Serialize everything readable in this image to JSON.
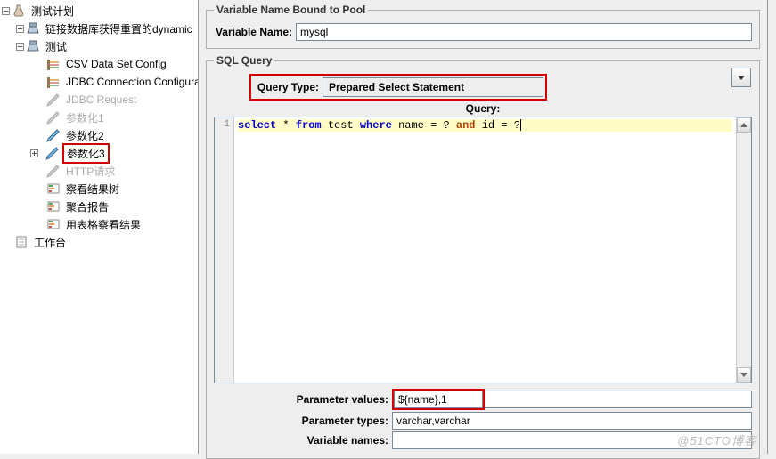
{
  "tree": {
    "root": "测试计划",
    "n1": "链接数据库获得重置的dynamic",
    "n2": "测试",
    "n2a": "CSV Data Set Config",
    "n2b": "JDBC Connection Configurat",
    "n2c": "JDBC Request",
    "n2d": "参数化1",
    "n2e": "参数化2",
    "n2f": "参数化3",
    "n2g": "HTTP请求",
    "n2h": "察看结果树",
    "n2i": "聚合报告",
    "n2j": "用表格察看结果",
    "wb": "工作台"
  },
  "panel": {
    "fs1_title": "Variable Name Bound to Pool",
    "varname_lbl": "Variable Name:",
    "varname_val": "mysql",
    "fs2_title": "SQL Query",
    "qtype_lbl": "Query Type:",
    "qtype_val": "Prepared Select Statement",
    "query_lbl": "Query:",
    "gutter1": "1",
    "pv_lbl": "Parameter values:",
    "pv_val": "${name},1",
    "pt_lbl": "Parameter types:",
    "pt_val": "varchar,varchar",
    "vn_lbl": "Variable names:",
    "vn_val": ""
  },
  "sql": {
    "select": "select",
    "star": " * ",
    "from": "from",
    "test": " test ",
    "where": "where",
    "sp": "   name = ? ",
    "and": "and",
    "rest": " id = ?"
  },
  "watermark": "@51CTO博客"
}
